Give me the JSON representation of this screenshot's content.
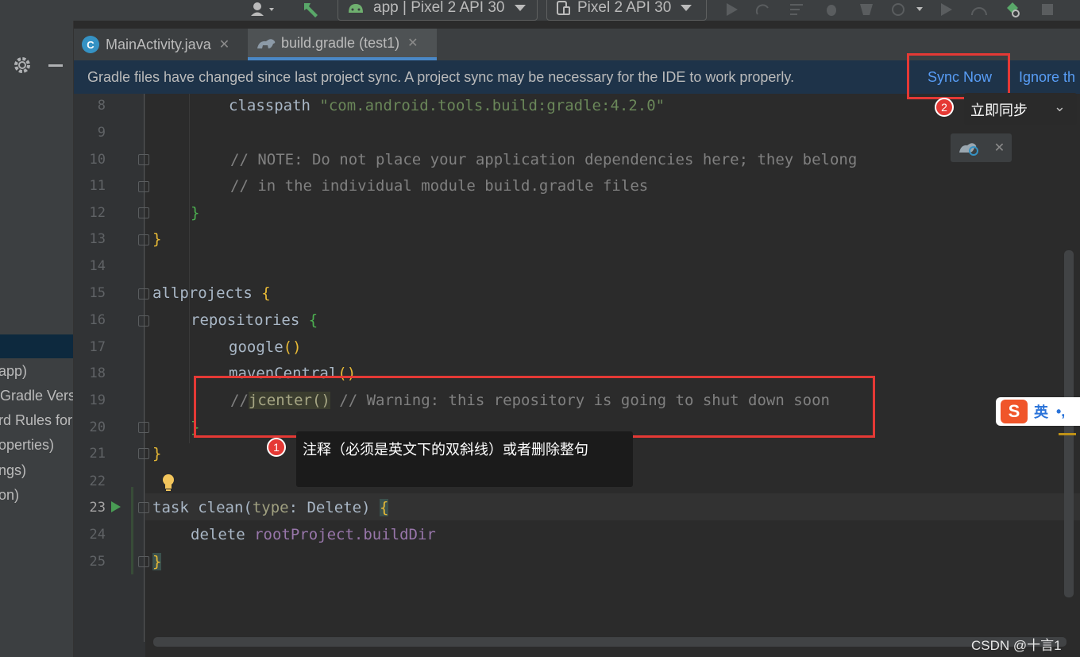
{
  "toolbar": {
    "run_config": "app | Pixel 2 API 30",
    "device": "Pixel 2 API 30"
  },
  "tabs": [
    {
      "label": "MainActivity.java",
      "icon": "java-class-icon"
    },
    {
      "label": "build.gradle (test1)",
      "icon": "gradle-icon",
      "active": true
    }
  ],
  "banner": {
    "message": "Gradle files have changed since last project sync. A project sync may be necessary for the IDE to work properly.",
    "sync_now": "Sync Now",
    "ignore": "Ignore th"
  },
  "project_panel": {
    "items": [
      "app)",
      "Gradle Vers",
      "rd Rules for",
      "operties)",
      "ngs)",
      "on)"
    ]
  },
  "editor": {
    "line_numbers": [
      "8",
      "9",
      "10",
      "11",
      "12",
      "13",
      "14",
      "15",
      "16",
      "17",
      "18",
      "19",
      "20",
      "21",
      "22",
      "23",
      "24",
      "25"
    ],
    "current_line": "23",
    "lines": {
      "l8_a": "classpath ",
      "l8_b": "\"com.android.tools.build:gradle:4.2.0\"",
      "l10": "// NOTE: Do not place your application dependencies here; they belong",
      "l11": "// in the individual module build.gradle files",
      "l12": "}",
      "l13": "}",
      "l15_a": "allprojects ",
      "l15_b": "{",
      "l16_a": "repositories ",
      "l16_b": "{",
      "l17_a": "google",
      "l17_b": "()",
      "l18_a": "mavenCentral",
      "l18_b": "()",
      "l19_a": "//",
      "l19_b": "jcenter()",
      "l19_c": " // Warning: this repository is going to shut down soon",
      "l20": "}",
      "l21": "}",
      "l23_a": "task clean(",
      "l23_b": "type",
      "l23_c": ": Delete) ",
      "l23_d": "{",
      "l24_a": "delete ",
      "l24_b": "rootProject.buildDir",
      "l25": "}"
    }
  },
  "annotations": {
    "badge1": "1",
    "tooltip1": "注释（必须是英文下的双斜线）或者删除整句",
    "badge2": "2",
    "tooltip2": "立即同步"
  },
  "ime": {
    "label": "英"
  },
  "watermark": "CSDN @十言1"
}
